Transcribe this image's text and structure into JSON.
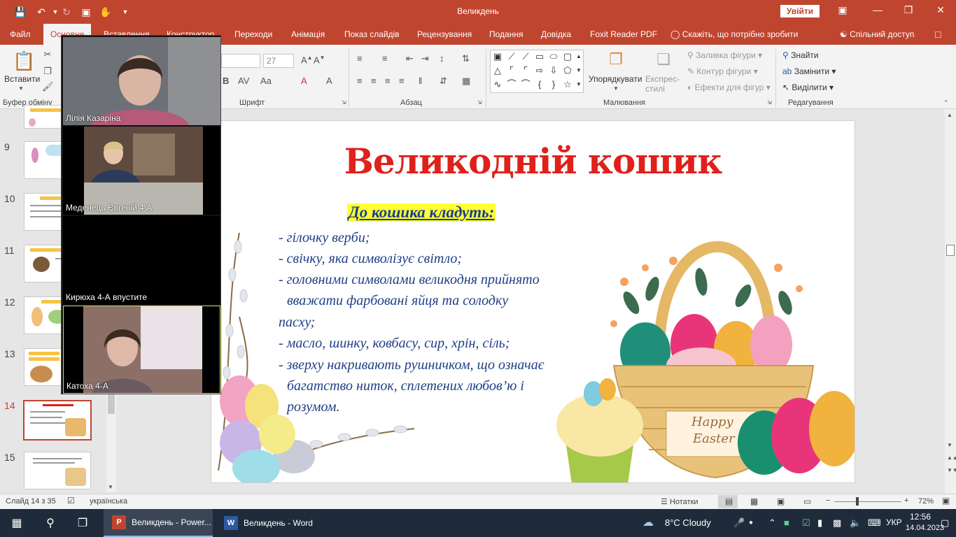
{
  "window": {
    "title": "Великдень",
    "sign_in": "Увійти",
    "quick_access": [
      "save-icon",
      "undo-icon",
      "redo-icon",
      "present-icon",
      "touch-icon",
      "more-icon"
    ],
    "controls": [
      "minimize-icon",
      "restore-icon",
      "close-icon"
    ]
  },
  "tabs": [
    {
      "label": "Файл"
    },
    {
      "label": "Основне",
      "active": true
    },
    {
      "label": "Вставлення"
    },
    {
      "label": "Конструктор"
    },
    {
      "label": "Переходи"
    },
    {
      "label": "Анімація"
    },
    {
      "label": "Показ слайдів"
    },
    {
      "label": "Рецензування"
    },
    {
      "label": "Подання"
    },
    {
      "label": "Довідка"
    },
    {
      "label": "Foxit Reader PDF"
    }
  ],
  "tell_me": "Скажіть, що потрібно зробити",
  "share": "Спільний доступ",
  "ribbon": {
    "groups": {
      "clipboard": "Буфер обміну",
      "font": "Шрифт",
      "paragraph": "Абзац",
      "drawing": "Малювання",
      "editing": "Редагування"
    },
    "paste": "Вставити",
    "font_size": "27",
    "arrange": "Упорядкувати",
    "quick_styles": "Експрес-стилі",
    "shape_fill": "Заливка фігури",
    "shape_outline": "Контур фігури",
    "shape_effects": "Ефекти для фігур",
    "find": "Знайти",
    "replace": "Замінити",
    "select": "Виділити"
  },
  "thumbnails": [
    {
      "num": "9"
    },
    {
      "num": "10"
    },
    {
      "num": "11"
    },
    {
      "num": "12"
    },
    {
      "num": "13"
    },
    {
      "num": "14",
      "current": true
    },
    {
      "num": "15"
    }
  ],
  "video_call": {
    "participants": [
      {
        "name": "Лілія Казаріна"
      },
      {
        "name": "Меденець Євгеній 4 А"
      },
      {
        "name": "Кирюха 4-А впустите"
      },
      {
        "name": "Катоха 4-А"
      }
    ]
  },
  "slide": {
    "title": "Великодній кошик",
    "subheading": "До кошика кладуть:",
    "lines": [
      "- гілочку верби;",
      "- свічку, яка символізує світло;",
      "- головними символами великодня прийнято",
      "  вважати фарбовані яйця  та солодку",
      "пасху;",
      "- масло, шинку, ковбасу, сир, хрін, сіль;",
      "- зверху накривають рушничком, що означає",
      "  багатство ниток, сплетених любов’ю і",
      "  розумом."
    ],
    "basket_tag_line1": "Happy",
    "basket_tag_line2": "Easter"
  },
  "status": {
    "slide_info": "Слайд 14 з 35",
    "language": "українська",
    "notes": "Нотатки",
    "zoom": "72%",
    "zoom_level_percent": 72
  },
  "taskbar": {
    "apps": [
      {
        "label": "Великдень - Power...",
        "logo": "P",
        "active": true
      },
      {
        "label": "Великдень - Word",
        "logo": "W",
        "active": false
      }
    ],
    "weather": "8°C  Cloudy",
    "lang": "УКР",
    "time": "12:56",
    "date": "14.04.2023"
  },
  "colors": {
    "accent": "#c0452f",
    "title_red": "#e0201b",
    "text_blue": "#1f3f86",
    "highlight": "#ffff33"
  }
}
